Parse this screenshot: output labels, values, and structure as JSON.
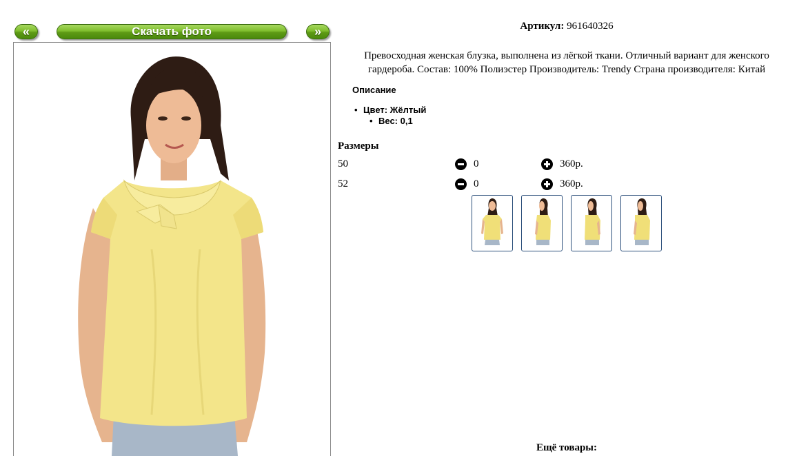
{
  "gallery": {
    "prev_label": "«",
    "next_label": "»",
    "download_label": "Скачать фото"
  },
  "product": {
    "article_label": "Артикул:",
    "article_value": "961640326",
    "description": "Превосходная женская блузка, выполнена из лёгкой ткани. Отличный вариант для женского гардероба. Состав: 100% Полиэстер Производитель: Trendy Страна производителя: Китай",
    "properties_heading": "Описание",
    "properties": [
      {
        "text": "Цвет: Жёлтый"
      },
      {
        "text": "Вес: 0,1"
      }
    ]
  },
  "sizes": {
    "heading": "Размеры",
    "rows": [
      {
        "size": "50",
        "qty": "0",
        "price": "360р."
      },
      {
        "size": "52",
        "qty": "0",
        "price": "360р."
      }
    ]
  },
  "thumbnails": [
    {
      "icon": "blouse-photo-front"
    },
    {
      "icon": "blouse-photo-side"
    },
    {
      "icon": "blouse-photo-side"
    },
    {
      "icon": "blouse-photo-side"
    }
  ],
  "more_products_label": "Ещё товары:",
  "colors": {
    "button_green": "#6aa91f",
    "blouse_yellow": "#f3e58a",
    "thumb_border": "#2a4e7a"
  }
}
